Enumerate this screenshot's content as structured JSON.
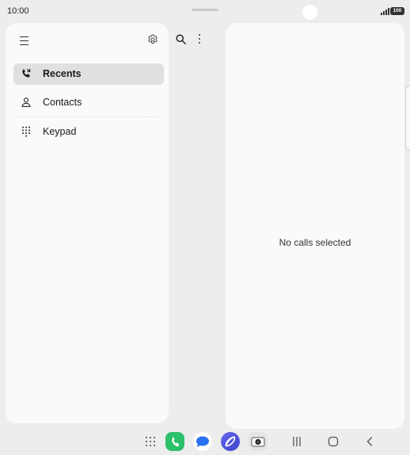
{
  "status_bar": {
    "time": "10:00",
    "battery": "100",
    "icons": [
      "signal-icon",
      "battery-icon"
    ]
  },
  "left_pane": {
    "menu_icon": "hamburger-menu-icon",
    "settings_icon": "gear-icon",
    "nav_items": [
      {
        "label": "Recents",
        "icon": "recent-calls-icon",
        "active": true
      },
      {
        "label": "Contacts",
        "icon": "person-icon",
        "active": false
      },
      {
        "label": "Keypad",
        "icon": "dialpad-icon",
        "active": false
      }
    ]
  },
  "toolbar": {
    "search_icon": "search-icon",
    "more_icon": "more-options-icon"
  },
  "detail_pane": {
    "empty_text": "No calls selected"
  },
  "taskbar": {
    "apps": [
      "apps-grid-icon",
      "phone-app-icon",
      "messages-app-icon",
      "internet-app-icon",
      "camera-app-icon"
    ],
    "nav_buttons": [
      "recent-apps-icon",
      "home-icon",
      "back-icon"
    ]
  },
  "colors": {
    "background": "#ededed",
    "pane": "#fafafa",
    "active_item": "#e0e0e0",
    "phone_app": "#2dc06a"
  }
}
